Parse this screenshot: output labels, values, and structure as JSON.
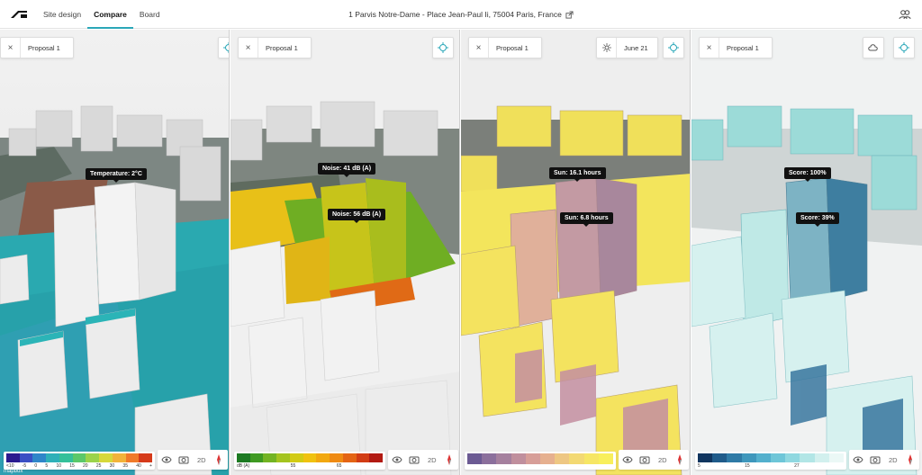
{
  "nav": {
    "tabs": [
      {
        "label": "Site design",
        "active": false
      },
      {
        "label": "Compare",
        "active": true
      },
      {
        "label": "Board",
        "active": false
      }
    ],
    "address": "1 Parvis Notre-Dame - Place Jean-Paul Ii, 75004 Paris, France"
  },
  "panels": [
    {
      "proposal": "Proposal 1",
      "labels": [
        "Temperature: 2°C"
      ],
      "legend": {
        "colors": [
          "#2b1b8f",
          "#3a4fc4",
          "#2f86c9",
          "#2fb0b8",
          "#35c09a",
          "#5bc86a",
          "#9bd34b",
          "#d7d83a",
          "#f2b33a",
          "#f07a2a",
          "#d63a1a"
        ],
        "ticks": [
          "<10",
          "-5",
          "0",
          "5",
          "10",
          "15",
          "20",
          "25",
          "30",
          "35",
          "40",
          "+"
        ]
      },
      "accent": "#2fb3b0"
    },
    {
      "proposal": "Proposal 1",
      "labels": [
        "Noise: 41 dB (A)",
        "Noise: 56 dB (A)"
      ],
      "legend": {
        "colors": [
          "#1c7a22",
          "#3f9a22",
          "#73b423",
          "#a4c41f",
          "#d2cb14",
          "#f0c20f",
          "#f2a80f",
          "#ef8a12",
          "#e46414",
          "#d23c14",
          "#b21a12"
        ],
        "ticks": [
          "dB (A)",
          "55",
          "65",
          ""
        ]
      },
      "accent": "#e8c018"
    },
    {
      "proposal": "Proposal 1",
      "date": "June 21",
      "labels": [
        "Sun: 16.1 hours",
        "Sun: 6.8 hours"
      ],
      "legend": {
        "colors": [
          "#6b5a93",
          "#8b6f9c",
          "#a5809e",
          "#c08f9d",
          "#d79e98",
          "#e6b08f",
          "#eec783",
          "#f3d973",
          "#f6e665",
          "#f8ef5c"
        ],
        "ticks": []
      },
      "accent": "#f2e65c"
    },
    {
      "proposal": "Proposal 1",
      "labels": [
        "Score: 100%",
        "Score: 39%"
      ],
      "legend": {
        "colors": [
          "#10355f",
          "#1f5b8a",
          "#2e7aa6",
          "#3e97bc",
          "#53b0cd",
          "#6ec6d8",
          "#8fd8e0",
          "#b2e6e6",
          "#d2f0ee",
          "#ebf8f6"
        ],
        "ticks": [
          "5",
          "15",
          "27",
          ""
        ]
      },
      "accent": "#bfe9e6"
    }
  ],
  "tools": {
    "eye": "eye-icon",
    "camera": "camera-icon",
    "mode": "2D",
    "compass": "compass-icon"
  },
  "attribution": "mapbox"
}
